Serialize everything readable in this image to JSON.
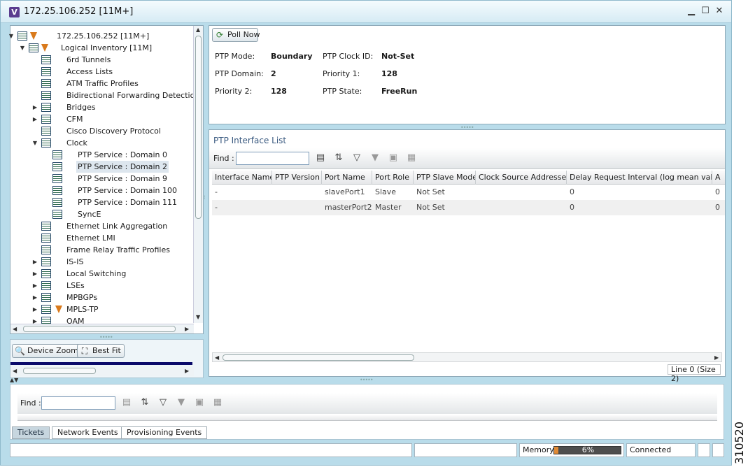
{
  "window": {
    "title": "172.25.106.252 [11M+]",
    "app_letter": "V",
    "controls": {
      "minimize": "▁",
      "maximize": "☐",
      "close": "✕"
    }
  },
  "tree": {
    "items": [
      {
        "label": "172.25.106.252 [11M+]",
        "level": 0,
        "expanded": true,
        "icon": "device-icon"
      },
      {
        "label": "Logical Inventory [11M]",
        "level": 1,
        "expanded": true,
        "icon": "inventory-icon"
      },
      {
        "label": "6rd Tunnels",
        "level": 2,
        "icon": "table-icon"
      },
      {
        "label": "Access Lists",
        "level": 2,
        "icon": "table-icon"
      },
      {
        "label": "ATM Traffic Profiles",
        "level": 2,
        "icon": "table-icon"
      },
      {
        "label": "Bidirectional Forwarding Detection",
        "level": 2,
        "icon": "table-icon"
      },
      {
        "label": "Bridges",
        "level": 2,
        "expandable": true,
        "icon": "table-icon"
      },
      {
        "label": "CFM",
        "level": 2,
        "expandable": true,
        "icon": "cfm-icon"
      },
      {
        "label": "Cisco Discovery Protocol",
        "level": 2,
        "icon": "table-icon"
      },
      {
        "label": "Clock",
        "level": 2,
        "expanded": true,
        "icon": "table-icon"
      },
      {
        "label": "PTP Service : Domain 0",
        "level": 3,
        "icon": "table-icon"
      },
      {
        "label": "PTP Service : Domain 2",
        "level": 3,
        "icon": "table-icon",
        "selected": true
      },
      {
        "label": "PTP Service : Domain 9",
        "level": 3,
        "icon": "table-icon"
      },
      {
        "label": "PTP Service : Domain 100",
        "level": 3,
        "icon": "table-icon"
      },
      {
        "label": "PTP Service : Domain 111",
        "level": 3,
        "icon": "table-icon"
      },
      {
        "label": "SyncE",
        "level": 3,
        "icon": "table-icon"
      },
      {
        "label": "Ethernet Link Aggregation",
        "level": 2,
        "icon": "table-icon"
      },
      {
        "label": "Ethernet LMI",
        "level": 2,
        "icon": "table-icon"
      },
      {
        "label": "Frame Relay Traffic Profiles",
        "level": 2,
        "icon": "table-icon"
      },
      {
        "label": "IS-IS",
        "level": 2,
        "expandable": true,
        "icon": "table-icon"
      },
      {
        "label": "Local Switching",
        "level": 2,
        "expandable": true,
        "icon": "table-icon"
      },
      {
        "label": "LSEs",
        "level": 2,
        "expandable": true,
        "icon": "table-icon"
      },
      {
        "label": "MPBGPs",
        "level": 2,
        "expandable": true,
        "icon": "table-icon"
      },
      {
        "label": "MPLS-TP",
        "level": 2,
        "expandable": true,
        "icon": "table-icon",
        "alarm": true
      },
      {
        "label": "OAM",
        "level": 2,
        "expandable": true,
        "icon": "table-icon"
      }
    ]
  },
  "zoom": {
    "device_zoom_label": "Device Zoom",
    "best_fit_label": "Best Fit"
  },
  "properties": {
    "poll_now_label": "Poll Now",
    "fields": [
      {
        "label": "PTP Mode:",
        "value": "Boundary"
      },
      {
        "label": "PTP Clock ID:",
        "value": "Not-Set"
      },
      {
        "label": "PTP Domain:",
        "value": "2"
      },
      {
        "label": "Priority 1:",
        "value": "128"
      },
      {
        "label": "Priority 2:",
        "value": "128"
      },
      {
        "label": "PTP State:",
        "value": "FreeRun"
      }
    ]
  },
  "interface_list": {
    "title": "PTP Interface List",
    "find_label": "Find :",
    "find_value": "",
    "columns": [
      "Interface Name",
      "PTP Version",
      "Port Name",
      "Port Role",
      "PTP Slave Mode",
      "Clock Source Addresses",
      "Delay Request Interval (log mean value)",
      "A"
    ],
    "rows": [
      [
        "-",
        "",
        "slavePort1",
        "Slave",
        "Not Set",
        "",
        "0",
        "0"
      ],
      [
        "-",
        "",
        "masterPort2",
        "Master",
        "Not Set",
        "",
        "0",
        "0"
      ]
    ],
    "status": "Line 0 (Size 2)"
  },
  "bottom": {
    "find_label": "Find :",
    "find_value": "",
    "tabs": [
      {
        "label": "Tickets",
        "active": true
      },
      {
        "label": "Network Events",
        "active": false
      },
      {
        "label": "Provisioning Events",
        "active": false
      }
    ]
  },
  "statusbar": {
    "memory_label": "Memory:",
    "memory_percent": 6,
    "memory_text": "6%",
    "connection": "Connected"
  },
  "side_tag": "310520"
}
